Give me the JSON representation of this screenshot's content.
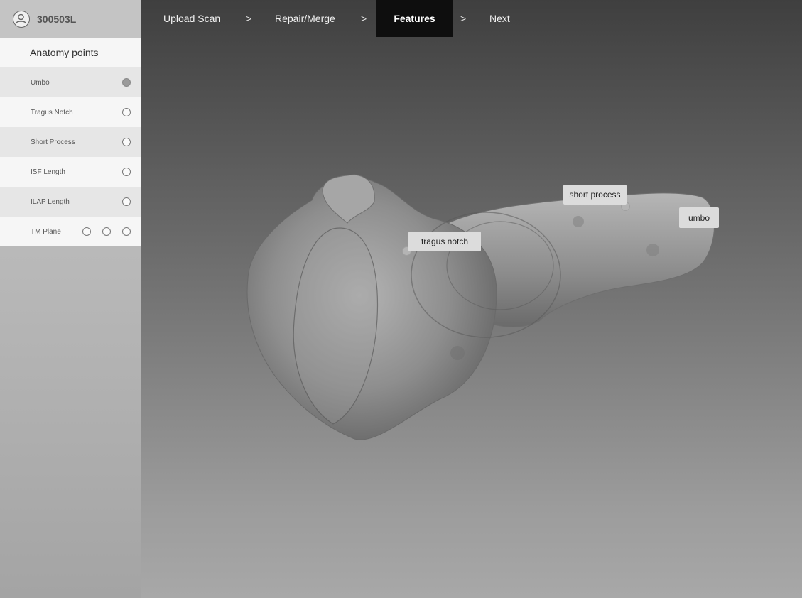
{
  "user": {
    "id": "300503L",
    "icon": "user-circle-icon"
  },
  "panel": {
    "title": "Anatomy points",
    "rows": [
      {
        "label": "Umbo",
        "checked": true
      },
      {
        "label": "Tragus Notch",
        "checked": false
      },
      {
        "label": "Short Process",
        "checked": false
      },
      {
        "label": "ISF Length",
        "checked": false
      },
      {
        "label": "ILAP Length",
        "checked": false
      },
      {
        "label": "TM Plane",
        "checked": false
      }
    ]
  },
  "nav": {
    "steps": [
      "Upload Scan",
      "Repair/Merge",
      "Features",
      "Next"
    ],
    "separator": ">",
    "active": "Features"
  },
  "viewport": {
    "labels": [
      "tragus notch",
      "short process",
      "umbo"
    ]
  }
}
